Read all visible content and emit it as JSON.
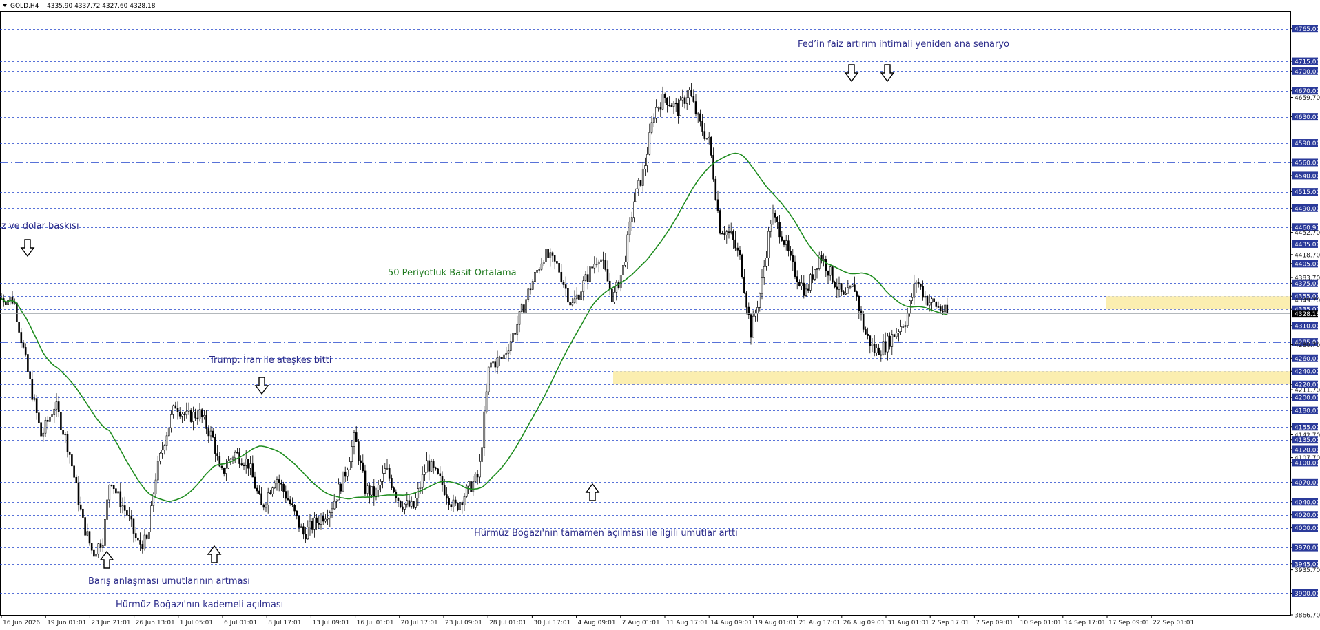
{
  "header": {
    "symbol": "GOLD,H4",
    "ohlc": "4335.90 4337.72 4327.60 4328.18"
  },
  "chart_data": {
    "type": "candlestick",
    "title": "GOLD,H4",
    "ylim": [
      3866.7,
      4790
    ],
    "y_axis_ticks": [
      "4765.00",
      "4715.00",
      "4700.00",
      "4670.00",
      "4659.70",
      "4630.00",
      "4590.00",
      "4560.00",
      "4540.00",
      "4515.00",
      "4490.00",
      "4460.97",
      "4452.70",
      "4435.00",
      "4418.70",
      "4405.00",
      "4383.70",
      "4375.00",
      "4355.00",
      "4349.70",
      "4335.00",
      "4310.00",
      "4285.00",
      "4280.70",
      "4260.00",
      "4240.00",
      "4220.00",
      "4211.70",
      "4200.00",
      "4180.00",
      "4155.00",
      "4142.70",
      "4135.00",
      "4120.00",
      "4107.70",
      "4100.00",
      "4070.00",
      "4040.00",
      "4020.00",
      "4000.00",
      "3970.00",
      "3945.00",
      "3935.70",
      "3900.00",
      "3866.70"
    ],
    "highlighted_levels": [
      "4765.00",
      "4715.00",
      "4700.00",
      "4670.00",
      "4630.00",
      "4590.00",
      "4560.00",
      "4540.00",
      "4515.00",
      "4490.00",
      "4460.97",
      "4435.00",
      "4405.00",
      "4375.00",
      "4355.00",
      "4335.00",
      "4310.00",
      "4285.00",
      "4260.00",
      "4240.00",
      "4220.00",
      "4200.00",
      "4180.00",
      "4155.00",
      "4135.00",
      "4120.00",
      "4100.00",
      "4070.00",
      "4040.00",
      "4020.00",
      "4000.00",
      "3970.00",
      "3945.00",
      "3900.00"
    ],
    "current_price": "4328.18",
    "x_axis_labels": [
      "16 Jun 2026",
      "19 Jun 01:01",
      "23 Jun 21:01",
      "26 Jun 13:01",
      "1 Jul 05:01",
      "6 Jul 01:01",
      "8 Jul 17:01",
      "13 Jul 09:01",
      "16 Jul 01:01",
      "20 Jul 17:01",
      "23 Jul 09:01",
      "28 Jul 01:01",
      "30 Jul 17:01",
      "4 Aug 09:01",
      "7 Aug 01:01",
      "11 Aug 17:01",
      "14 Aug 09:01",
      "19 Aug 01:01",
      "21 Aug 17:01",
      "26 Aug 09:01",
      "31 Aug 01:01",
      "2 Sep 17:01",
      "7 Sep 09:01",
      "10 Sep 01:01",
      "14 Sep 17:01",
      "17 Sep 09:01",
      "22 Sep 01:01"
    ],
    "price_path": [
      [
        0,
        4352
      ],
      [
        20,
        4350
      ],
      [
        40,
        4240
      ],
      [
        60,
        4140
      ],
      [
        80,
        4190
      ],
      [
        100,
        4120
      ],
      [
        120,
        4010
      ],
      [
        135,
        3960
      ],
      [
        150,
        3985
      ],
      [
        160,
        4080
      ],
      [
        170,
        4050
      ],
      [
        185,
        4020
      ],
      [
        200,
        3975
      ],
      [
        215,
        3980
      ],
      [
        225,
        4075
      ],
      [
        240,
        4140
      ],
      [
        255,
        4190
      ],
      [
        270,
        4170
      ],
      [
        290,
        4175
      ],
      [
        310,
        4135
      ],
      [
        320,
        4080
      ],
      [
        340,
        4115
      ],
      [
        360,
        4100
      ],
      [
        380,
        4030
      ],
      [
        400,
        4080
      ],
      [
        420,
        4040
      ],
      [
        440,
        3990
      ],
      [
        460,
        4010
      ],
      [
        480,
        4030
      ],
      [
        500,
        4080
      ],
      [
        515,
        4140
      ],
      [
        530,
        4060
      ],
      [
        545,
        4050
      ],
      [
        560,
        4090
      ],
      [
        580,
        4040
      ],
      [
        600,
        4030
      ],
      [
        620,
        4100
      ],
      [
        640,
        4070
      ],
      [
        660,
        4030
      ],
      [
        680,
        4060
      ],
      [
        695,
        4080
      ],
      [
        710,
        4250
      ],
      [
        730,
        4260
      ],
      [
        750,
        4310
      ],
      [
        770,
        4370
      ],
      [
        790,
        4420
      ],
      [
        810,
        4400
      ],
      [
        830,
        4340
      ],
      [
        850,
        4380
      ],
      [
        870,
        4420
      ],
      [
        890,
        4350
      ],
      [
        905,
        4400
      ],
      [
        920,
        4500
      ],
      [
        935,
        4550
      ],
      [
        950,
        4640
      ],
      [
        965,
        4660
      ],
      [
        985,
        4640
      ],
      [
        1000,
        4670
      ],
      [
        1015,
        4620
      ],
      [
        1030,
        4590
      ],
      [
        1045,
        4460
      ],
      [
        1060,
        4450
      ],
      [
        1075,
        4410
      ],
      [
        1090,
        4300
      ],
      [
        1105,
        4370
      ],
      [
        1120,
        4480
      ],
      [
        1135,
        4450
      ],
      [
        1150,
        4400
      ],
      [
        1170,
        4360
      ],
      [
        1190,
        4420
      ],
      [
        1210,
        4380
      ],
      [
        1225,
        4350
      ],
      [
        1240,
        4370
      ],
      [
        1255,
        4300
      ],
      [
        1270,
        4270
      ],
      [
        1285,
        4280
      ],
      [
        1300,
        4300
      ],
      [
        1315,
        4320
      ],
      [
        1330,
        4380
      ],
      [
        1345,
        4350
      ],
      [
        1360,
        4340
      ],
      [
        1375,
        4328
      ]
    ],
    "annotations": [
      "Fed’in faiz artırım ihtimali yeniden ana senaryo",
      "50 Periyotluk Basit Ortalama",
      "Trump: İran ile ateşkes bitti",
      "Hürmüz Boğazı'nın tamamen açılması ile ilgili umutlar arttı",
      "Barış anlaşması umutlarının artması",
      "Hürmüz Boğazı'nın kademeli açılması",
      "z ve dolar baskısı"
    ],
    "zones": [
      {
        "from": 4335,
        "to": 4355,
        "color": "#fbeeb0"
      },
      {
        "from": 4220,
        "to": 4240,
        "color": "#fbeeb0"
      }
    ],
    "moving_average_label": "50 Periyotluk Basit Ortalama",
    "colors": {
      "candle": "#000000",
      "ma": "#1e8c1e",
      "grid": "#2244cc",
      "tag_bg": "#2a3a9a"
    }
  }
}
